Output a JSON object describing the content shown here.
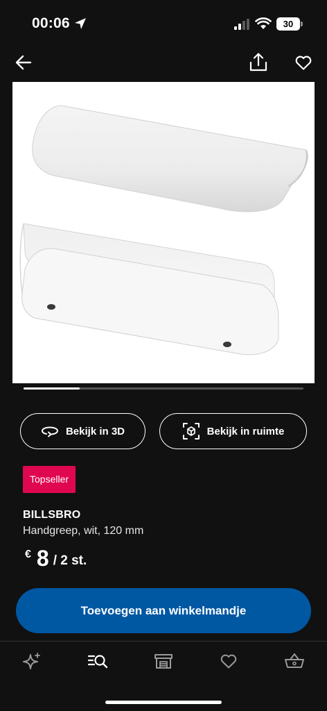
{
  "status_bar": {
    "time": "00:06",
    "battery": "30",
    "icons": [
      "location-arrow-icon",
      "cellular-signal-icon",
      "wifi-icon",
      "battery-icon"
    ]
  },
  "nav": {
    "icons": [
      "back-arrow-icon",
      "share-icon",
      "heart-outline-icon"
    ]
  },
  "carousel": {
    "current_index": 1,
    "total": 4,
    "progress": 0.2
  },
  "actions": {
    "view_3d": "Bekijk in 3D",
    "view_room": "Bekijk in ruimte"
  },
  "badge": "Topseller",
  "product": {
    "name": "BILLSBRO",
    "description": "Handgreep, wit, 120 mm",
    "currency": "€",
    "price": "8",
    "unit": "/ 2 st."
  },
  "cart_button": "Toevoegen aan winkelmandje",
  "tab_bar": {
    "icons": [
      "sparkle-icon",
      "search-list-icon",
      "store-icon",
      "heart-icon",
      "basket-icon"
    ]
  },
  "colors": {
    "background": "#111111",
    "accent_blue": "#0058a3",
    "badge_red": "#e00751",
    "icon_gray": "#9a9a9a"
  }
}
